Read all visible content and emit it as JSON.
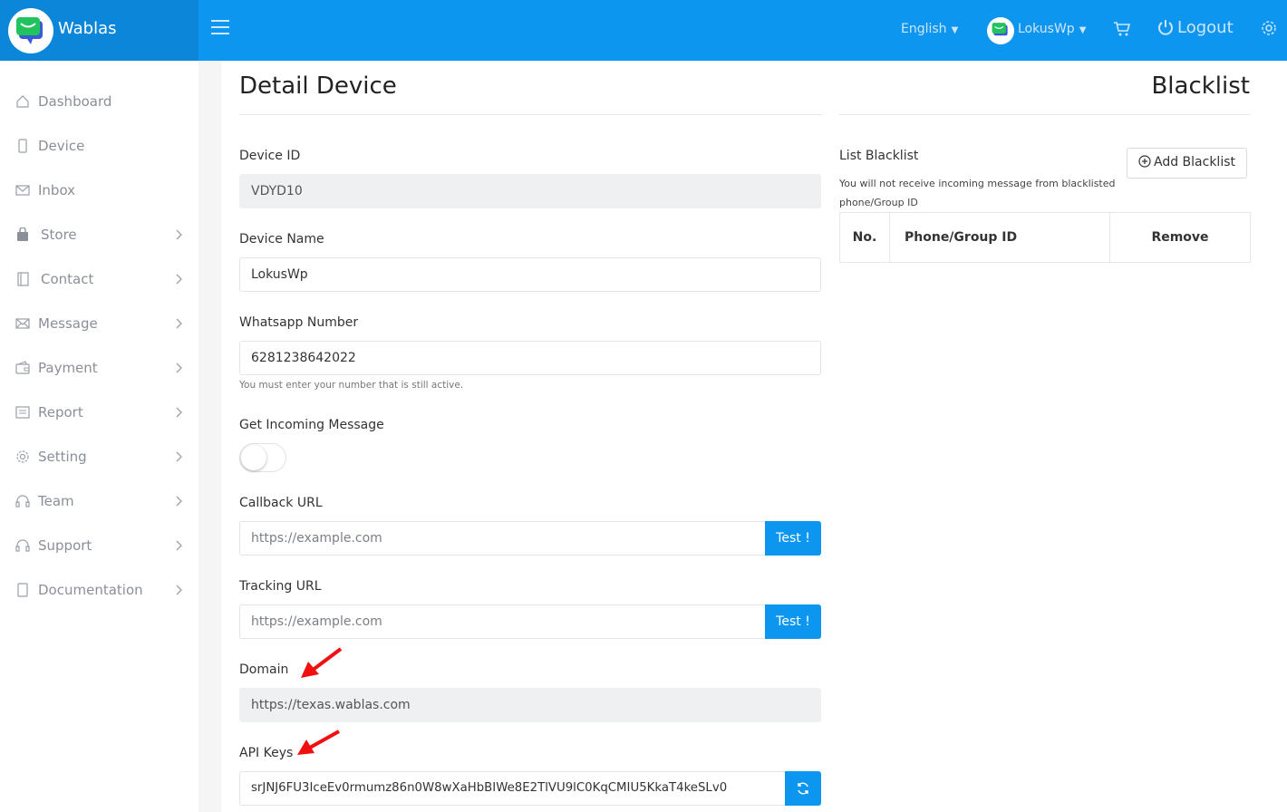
{
  "header": {
    "brand": "Wablas",
    "language": "English",
    "user": "LokusWp",
    "logout": "Logout"
  },
  "sidebar": {
    "items": [
      {
        "label": "Dashboard",
        "icon": "home-icon",
        "chevron": false
      },
      {
        "label": "Device",
        "icon": "phone-icon",
        "chevron": false
      },
      {
        "label": "Inbox",
        "icon": "mail-icon",
        "chevron": false
      },
      {
        "label": "Store",
        "icon": "bag-icon",
        "chevron": true
      },
      {
        "label": "Contact",
        "icon": "address-book-icon",
        "chevron": true
      },
      {
        "label": "Message",
        "icon": "envelope-icon",
        "chevron": true
      },
      {
        "label": "Payment",
        "icon": "wallet-icon",
        "chevron": true
      },
      {
        "label": "Report",
        "icon": "report-icon",
        "chevron": true
      },
      {
        "label": "Setting",
        "icon": "gear-icon",
        "chevron": true
      },
      {
        "label": "Team",
        "icon": "headset-icon",
        "chevron": true
      },
      {
        "label": "Support",
        "icon": "headset-icon",
        "chevron": true
      },
      {
        "label": "Documentation",
        "icon": "document-icon",
        "chevron": true
      }
    ]
  },
  "detail": {
    "title": "Detail Device",
    "device_id_label": "Device ID",
    "device_id": "VDYD10",
    "device_name_label": "Device Name",
    "device_name": "LokusWp",
    "whatsapp_label": "Whatsapp Number",
    "whatsapp_number": "6281238642022",
    "whatsapp_help": "You must enter your number that is still active.",
    "incoming_label": "Get Incoming Message",
    "incoming_enabled": false,
    "callback_label": "Callback URL",
    "callback_placeholder": "https://example.com",
    "test_label": "Test !",
    "tracking_label": "Tracking URL",
    "tracking_placeholder": "https://example.com",
    "domain_label": "Domain",
    "domain": "https://texas.wablas.com",
    "api_label": "API Keys",
    "api_key": "srJNJ6FU3IceEv0rmumz86n0W8wXaHbBIWe8E2TlVU9lC0KqCMIU5KkaT4keSLv0"
  },
  "blacklist": {
    "title": "Blacklist",
    "list_label": "List Blacklist",
    "add_button": "Add Blacklist",
    "description_line1": "You will not receive incoming message from blacklisted",
    "description_line2": "phone/Group ID",
    "columns": [
      "No.",
      "Phone/Group ID",
      "Remove"
    ]
  },
  "colors": {
    "primary": "#0d96ef",
    "brand_bg": "#0b86d8",
    "annotation_arrow": "#f01010"
  }
}
